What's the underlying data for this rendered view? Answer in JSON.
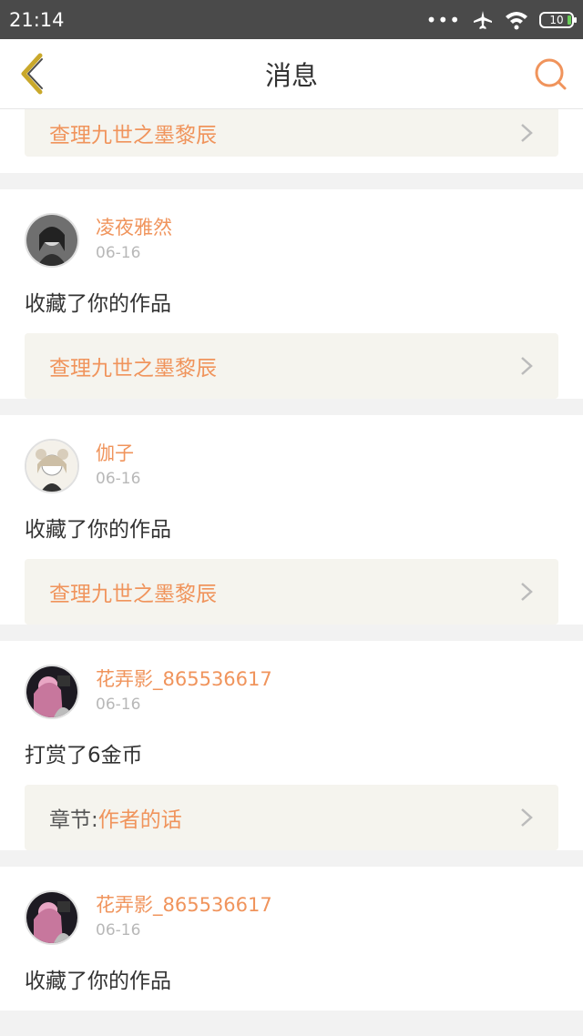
{
  "status": {
    "time": "21:14",
    "dots": "•••",
    "battery": "10"
  },
  "nav": {
    "title": "消息"
  },
  "colors": {
    "accent": "#f0945c",
    "back_icon": "#c9a82b"
  },
  "icons": {
    "back": "chevron-left-icon",
    "search": "search-icon",
    "more": "chevron-right-icon",
    "airplane": "airplane-icon",
    "wifi": "wifi-icon"
  },
  "top_partial": {
    "work_title": "查理九世之墨黎辰"
  },
  "messages": [
    {
      "user": "凌夜雅然",
      "date": "06-16",
      "action": "收藏了你的作品",
      "work_prefix": "",
      "work_title": "查理九世之墨黎辰"
    },
    {
      "user": "伽子",
      "date": "06-16",
      "action": "收藏了你的作品",
      "work_prefix": "",
      "work_title": "查理九世之墨黎辰"
    },
    {
      "user": "花弄影_865536617",
      "date": "06-16",
      "action": "打赏了6金币",
      "work_prefix": "章节:",
      "work_title": "作者的话"
    },
    {
      "user": "花弄影_865536617",
      "date": "06-16",
      "action": "收藏了你的作品"
    }
  ]
}
